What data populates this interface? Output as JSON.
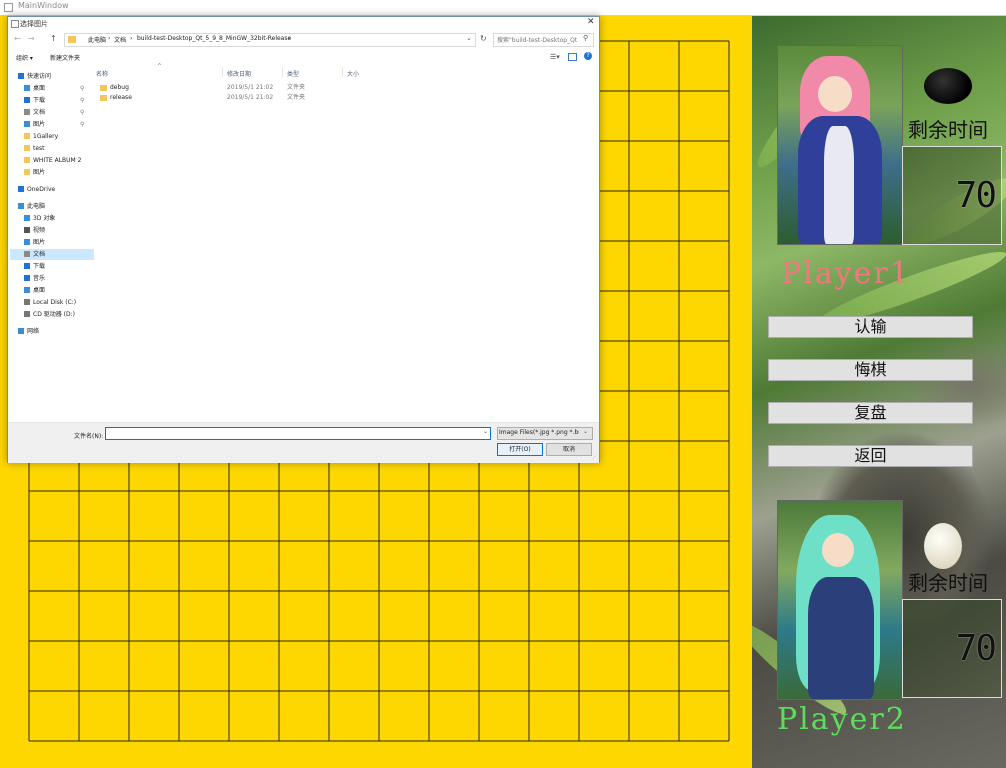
{
  "window": {
    "title": "MainWindow"
  },
  "board": {
    "color": "#FFD700",
    "line_color": "#2a2a2a",
    "lines": 15
  },
  "player1": {
    "name": "Player1",
    "stone": "black",
    "time_label": "剩余时间",
    "time": "70",
    "name_color": "#f07880"
  },
  "player2": {
    "name": "Player2",
    "stone": "white",
    "time_label": "剩余时间",
    "time": "70",
    "name_color": "#5edc5e"
  },
  "buttons": {
    "resign": "认输",
    "undo": "悔棋",
    "replay": "复盘",
    "back": "返回"
  },
  "dialog": {
    "title": "选择图片",
    "breadcrumbs": [
      "此电脑",
      "文档",
      "build-test-Desktop_Qt_5_9_8_MinGW_32bit-Release"
    ],
    "search_placeholder": "搜索\"build-test-Desktop_Qt_5...\"",
    "toolbar": {
      "organize": "组织 ▾",
      "new_folder": "新建文件夹"
    },
    "nav": [
      {
        "label": "快速访问",
        "icon": "star-icon",
        "color": "#1e73d8",
        "indent": 0
      },
      {
        "label": "桌面",
        "icon": "desktop-icon",
        "color": "#3a8ed8",
        "indent": 1,
        "pin": true
      },
      {
        "label": "下载",
        "icon": "download-icon",
        "color": "#1e73d8",
        "indent": 1,
        "pin": true
      },
      {
        "label": "文档",
        "icon": "documents-icon",
        "color": "#8a8a8a",
        "indent": 1,
        "pin": true
      },
      {
        "label": "图片",
        "icon": "pictures-icon",
        "color": "#3a8ed8",
        "indent": 1,
        "pin": true
      },
      {
        "label": "1Gallery",
        "icon": "folder-icon",
        "color": "#f1c75b",
        "indent": 1
      },
      {
        "label": "test",
        "icon": "folder-icon",
        "color": "#f1c75b",
        "indent": 1
      },
      {
        "label": "WHITE ALBUM 2",
        "icon": "folder-icon",
        "color": "#f1c75b",
        "indent": 1
      },
      {
        "label": "图片",
        "icon": "folder-icon",
        "color": "#f1c75b",
        "indent": 1
      },
      {
        "label": "OneDrive",
        "icon": "cloud-icon",
        "color": "#1e73d8",
        "indent": 0,
        "gap": true
      },
      {
        "label": "此电脑",
        "icon": "computer-icon",
        "color": "#3a8ed8",
        "indent": 0,
        "gap": true
      },
      {
        "label": "3D 对象",
        "icon": "cube-icon",
        "color": "#3a8ed8",
        "indent": 1
      },
      {
        "label": "视频",
        "icon": "video-icon",
        "color": "#555555",
        "indent": 1
      },
      {
        "label": "图片",
        "icon": "pictures-icon",
        "color": "#3a8ed8",
        "indent": 1
      },
      {
        "label": "文档",
        "icon": "documents-icon",
        "color": "#8a8a8a",
        "indent": 1,
        "selected": true
      },
      {
        "label": "下载",
        "icon": "download-icon",
        "color": "#1e73d8",
        "indent": 1
      },
      {
        "label": "音乐",
        "icon": "music-icon",
        "color": "#1e73d8",
        "indent": 1
      },
      {
        "label": "桌面",
        "icon": "desktop-icon",
        "color": "#3a8ed8",
        "indent": 1
      },
      {
        "label": "Local Disk (C:)",
        "icon": "drive-icon",
        "color": "#777777",
        "indent": 1
      },
      {
        "label": "CD 驱动器 (D:)",
        "icon": "cd-icon",
        "color": "#777777",
        "indent": 1
      },
      {
        "label": "网络",
        "icon": "network-icon",
        "color": "#3a8ed8",
        "indent": 0,
        "gap": true
      }
    ],
    "columns": [
      "名称",
      "修改日期",
      "类型",
      "大小"
    ],
    "files": [
      {
        "name": "debug",
        "date": "2019/5/1 21:02",
        "type": "文件夹"
      },
      {
        "name": "release",
        "date": "2019/5/1 21:02",
        "type": "文件夹"
      }
    ],
    "filename_label": "文件名(N):",
    "filename_value": "",
    "filter": "Image Files(*.jpg *.png *.bm",
    "open_button": "打开(O)",
    "cancel_button": "取消"
  }
}
